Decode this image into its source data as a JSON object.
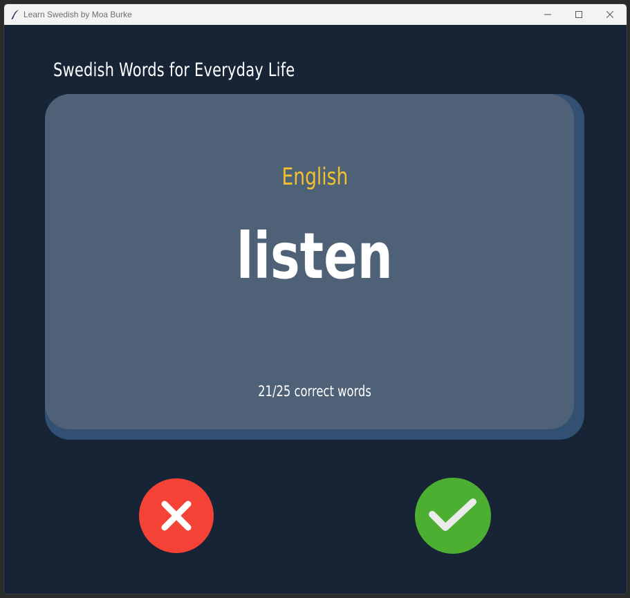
{
  "window": {
    "title": "Learn Swedish by Moa Burke",
    "controls": {
      "minimize_icon": "minimize-icon",
      "maximize_icon": "maximize-icon",
      "close_icon": "close-icon"
    }
  },
  "main": {
    "heading": "Swedish Words for Everyday Life"
  },
  "card": {
    "language": "English",
    "word": "listen",
    "score": "21/25 correct words"
  },
  "actions": {
    "wrong_icon": "x-mark-icon",
    "right_icon": "check-mark-icon"
  },
  "colors": {
    "background": "#172435",
    "card": "#4f6177",
    "card_shadow": "#325172",
    "language_label": "#f2c12e",
    "wrong_button": "#f44336",
    "right_button": "#4caf32"
  }
}
